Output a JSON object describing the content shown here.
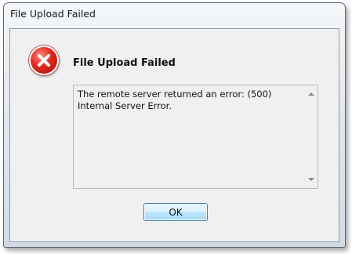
{
  "window": {
    "title": "File Upload Failed"
  },
  "dialog": {
    "icon": "error-icon",
    "heading": "File Upload Failed",
    "message_lines": [
      "The remote server returned an error: (500)",
      "Internal Server Error."
    ],
    "ok_label": "OK"
  },
  "colors": {
    "error_red": "#d9261c",
    "button_border": "#3c7fb1"
  }
}
